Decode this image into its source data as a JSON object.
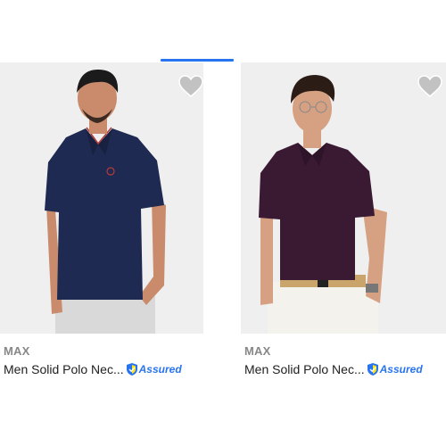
{
  "products": [
    {
      "brand": "MAX",
      "title": "Men Solid Polo Nec...",
      "badge": "Assured",
      "shirt_color": "#1f2a52",
      "wishlisted": false
    },
    {
      "brand": "MAX",
      "title": "Men Solid Polo Nec...",
      "badge": "Assured",
      "shirt_color": "#3a1a33",
      "wishlisted": false
    }
  ],
  "colors": {
    "accent": "#2874f0",
    "wishlist_icon": "#c2c2c2",
    "brand_text": "#878787"
  },
  "icons": {
    "wishlist": "heart-icon",
    "assured": "shield-icon"
  }
}
